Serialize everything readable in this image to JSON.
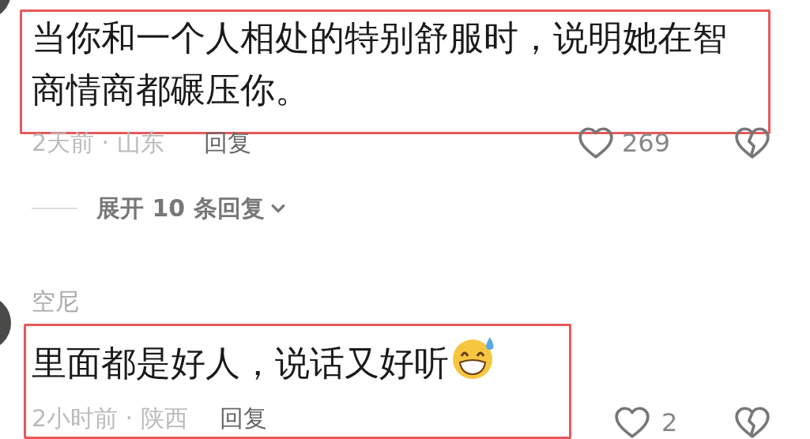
{
  "comments": [
    {
      "kind": "text_framed",
      "body": "当你和一个人相处的特别舒服时，说明她在智商情商都碾压你。",
      "time_location": "2天前 · 山东",
      "reply": "回复",
      "likes": "269",
      "replies_toggle": {
        "label": "展开 10 条回复"
      }
    },
    {
      "kind": "all_framed",
      "author": "空尼",
      "body": "里面都是好人，说话又好听",
      "emoji": true,
      "time_location": "2小时前 · 陕西",
      "reply": "回复",
      "likes": "2"
    }
  ]
}
